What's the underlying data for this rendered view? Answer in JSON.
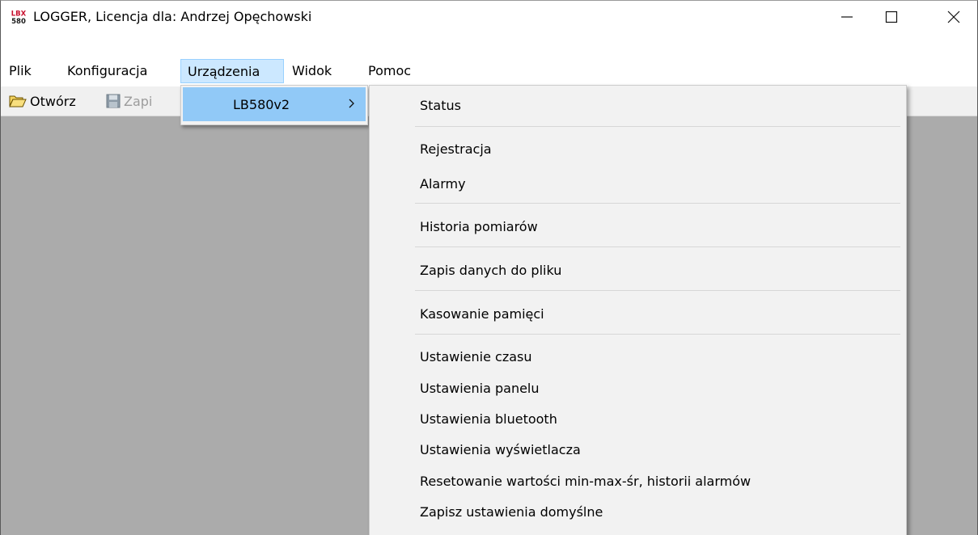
{
  "window": {
    "title": "LOGGER, Licencja dla: Andrzej Opęchowski",
    "icon": "lbx-580-app-icon",
    "icon_text_top": "LBX",
    "icon_text_bottom": "580",
    "controls": [
      "minimize-icon",
      "maximize-icon",
      "close-icon"
    ]
  },
  "menubar": {
    "items": [
      {
        "label": "Plik"
      },
      {
        "label": "Konfiguracja"
      },
      {
        "label": "Urządzenia",
        "active": true
      },
      {
        "label": "Widok"
      },
      {
        "label": "Pomoc"
      }
    ]
  },
  "toolbar": {
    "open_label": "Otwórz",
    "open_icon": "open-folder-icon",
    "save_label": "Zapi",
    "save_icon": "floppy-disk-icon"
  },
  "dropdown": {
    "items": [
      {
        "label": "LB580v2",
        "has_submenu": true
      }
    ]
  },
  "submenu": {
    "groups": [
      [
        "Status"
      ],
      [
        "Rejestracja",
        "Alarmy"
      ],
      [
        "Historia pomiarów"
      ],
      [
        "Zapis danych do pliku"
      ],
      [
        "Kasowanie pamięci"
      ],
      [
        "Ustawienie czasu",
        "Ustawienia panelu",
        "Ustawienia bluetooth",
        "Ustawienia wyświetlacza",
        "Resetowanie wartości min-max-śr, historii alarmów",
        "Zapisz ustawienia domyślne"
      ]
    ]
  },
  "colors": {
    "client_bg": "#ababab",
    "menu_highlight": "#cce8ff",
    "submenu_highlight": "#91c9f7",
    "menu_bg": "#f2f2f2",
    "icon_red": "#c8102e"
  }
}
